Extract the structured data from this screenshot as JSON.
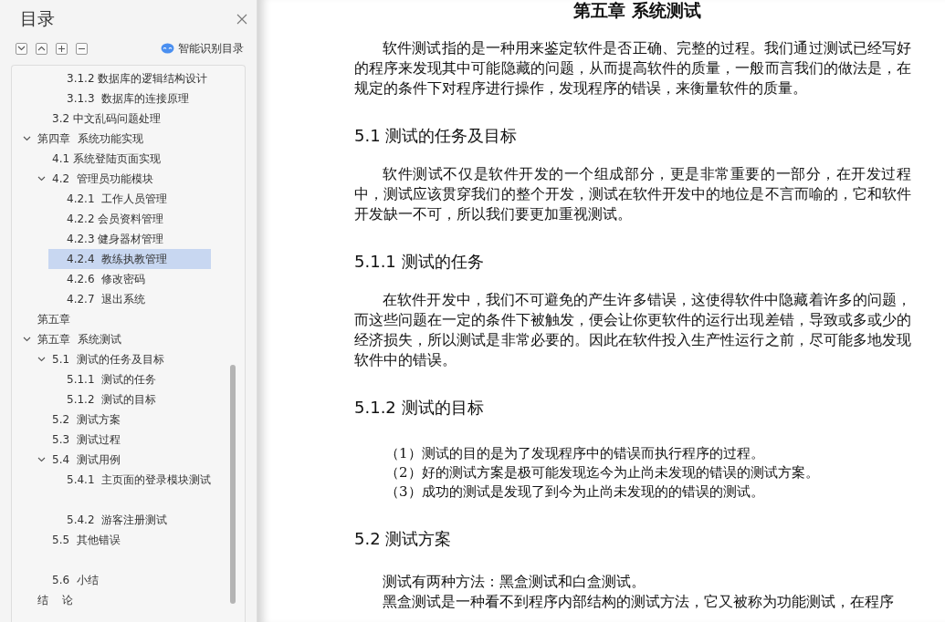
{
  "sidebar": {
    "title": "目录",
    "smart_toc_label": "智能识别目录",
    "items": [
      {
        "children": [
          {
            "children": [
              {
                "label": "3.1.2 数据库的逻辑结构设计",
                "selected": false
              },
              {
                "label": "3.1.3  数据库的连接原理",
                "selected": false
              }
            ]
          },
          {
            "label": "3.2 中文乱码问题处理",
            "selected": false
          }
        ]
      },
      {
        "label": "第四章  系统功能实现",
        "selected": false,
        "expanded": true,
        "children": [
          {
            "label": "4.1 系统登陆页面实现",
            "selected": false
          },
          {
            "label": "4.2  管理员功能模块",
            "selected": false,
            "expanded": true,
            "children": [
              {
                "label": "4.2.1  工作人员管理",
                "selected": false
              },
              {
                "label": "4.2.2 会员资料管理",
                "selected": false
              },
              {
                "label": "4.2.3 健身器材管理",
                "selected": false
              },
              {
                "label": "4.2.4  教练执教管理",
                "selected": true
              },
              {
                "label": "4.2.6  修改密码",
                "selected": false
              },
              {
                "label": "4.2.7  退出系统",
                "selected": false
              }
            ]
          }
        ]
      },
      {
        "label": "第五章",
        "selected": false
      },
      {
        "label": "第五章  系统测试",
        "selected": false,
        "expanded": true,
        "children": [
          {
            "label": "5.1  测试的任务及目标",
            "selected": false,
            "expanded": true,
            "children": [
              {
                "label": "5.1.1  测试的任务",
                "selected": false
              },
              {
                "label": "5.1.2  测试的目标",
                "selected": false
              }
            ]
          },
          {
            "label": "5.2  测试方案",
            "selected": false
          },
          {
            "label": "5.3  测试过程",
            "selected": false
          },
          {
            "label": "5.4  测试用例",
            "selected": false,
            "expanded": true,
            "children": [
              {
                "label": "5.4.1  主页面的登录模块测试",
                "selected": false,
                "blank_after": true
              },
              {
                "label": "5.4.2  游客注册测试",
                "selected": false
              }
            ]
          },
          {
            "label": "5.5  其他错误",
            "selected": false,
            "blank_after": true
          },
          {
            "label": "5.6  小结",
            "selected": false
          }
        ]
      },
      {
        "label": "结    论",
        "selected": false
      }
    ]
  },
  "document": {
    "blocks": [
      {
        "kind": "title",
        "text": "第五章  系统测试"
      },
      {
        "kind": "paragraph",
        "text": "软件测试指的是一种用来鉴定软件是否正确、完整的过程。我们通过测试已经写好的程序来发现其中可能隐藏的问题，从而提高软件的质量，一般而言我们的做法是，在规定的条件下对程序进行操作，发现程序的错误，来衡量软件的质量。"
      },
      {
        "kind": "heading",
        "text": "5.1  测试的任务及目标"
      },
      {
        "kind": "paragraph",
        "text": "软件测试不仅是软件开发的一个组成部分，更是非常重要的一部分，在开发过程中，测试应该贯穿我们的整个开发，测试在软件开发中的地位是不言而喻的，它和软件开发缺一不可，所以我们要更加重视测试。"
      },
      {
        "kind": "heading",
        "text": "5.1.1  测试的任务"
      },
      {
        "kind": "paragraph",
        "text": "在软件开发中，我们不可避免的产生许多错误，这使得软件中隐藏着许多的问题，而这些问题在一定的条件下被触发，便会让你更软件的运行出现差错，导致或多或少的经济损失，所以测试是非常必要的。因此在软件投入生产性运行之前，尽可能多地发现软件中的错误。"
      },
      {
        "kind": "heading",
        "text": "5.1.2  测试的目标"
      },
      {
        "kind": "list",
        "items": [
          "（1）测试的目的是为了发现程序中的错误而执行程序的过程。",
          "（2）好的测试方案是极可能发现迄今为止尚未发现的错误的测试方案。",
          "（3）成功的测试是发现了到今为止尚未发现的的错误的测试。"
        ]
      },
      {
        "kind": "heading",
        "text": "5.2  测试方案"
      },
      {
        "kind": "line",
        "text": "测试有两种方法：黑盒测试和白盒测试。"
      },
      {
        "kind": "line",
        "text": "黑盒测试是一种看不到程序内部结构的测试方法，它又被称为功能测试，在程序"
      }
    ]
  }
}
